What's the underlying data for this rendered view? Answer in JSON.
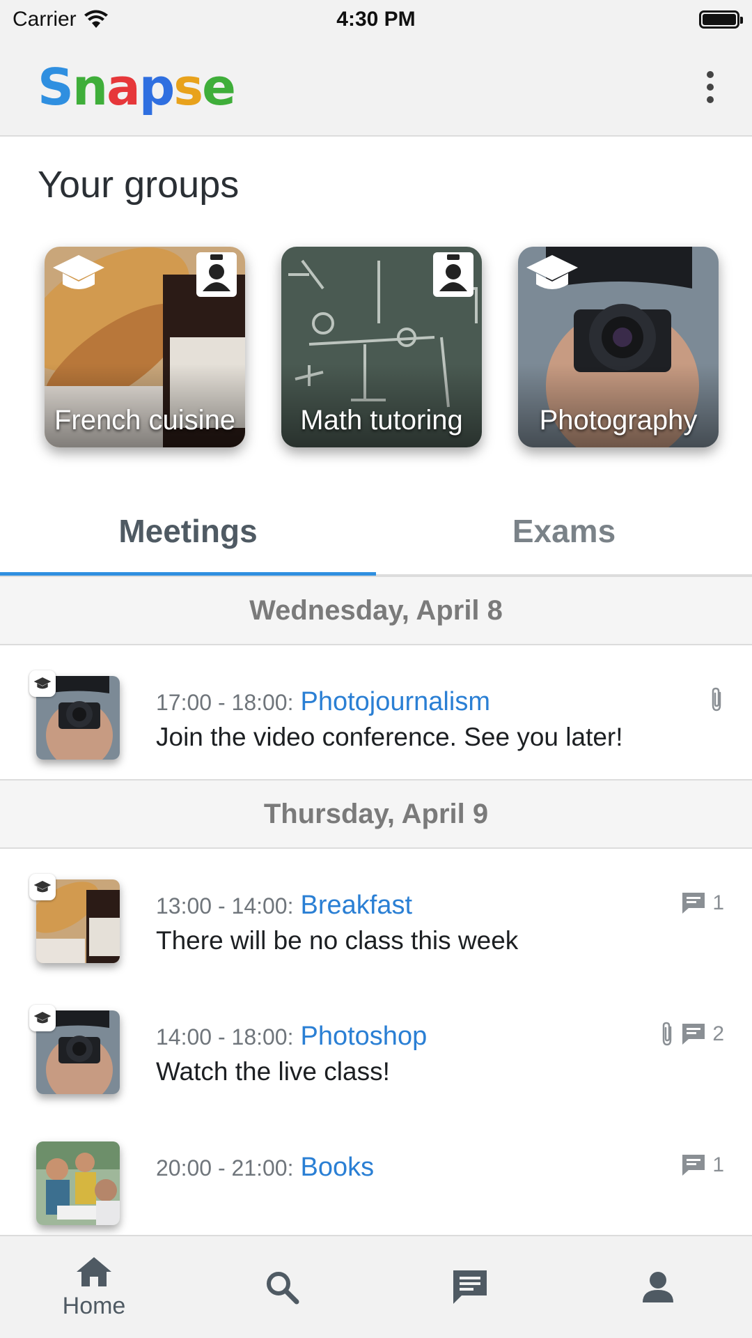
{
  "status_bar": {
    "carrier": "Carrier",
    "time": "4:30 PM"
  },
  "app_bar": {
    "logo": [
      "S",
      "n",
      "a",
      "p",
      "s",
      "e"
    ],
    "menu_icon": "more-vertical-icon"
  },
  "groups": {
    "title": "Your groups",
    "items": [
      {
        "label": "French cuisine",
        "role_icon": "graduation-cap-icon",
        "badge_icon": "id-badge-icon"
      },
      {
        "label": "Math tutoring",
        "role_icon": "",
        "badge_icon": "id-badge-icon"
      },
      {
        "label": "Photography",
        "role_icon": "graduation-cap-icon",
        "badge_icon": ""
      }
    ]
  },
  "tabs": [
    {
      "label": "Meetings",
      "active": true
    },
    {
      "label": "Exams",
      "active": false
    }
  ],
  "days": [
    {
      "header": "Wednesday, April 8",
      "meetings": [
        {
          "time": "17:00 - 18:00:",
          "title": "Photojournalism",
          "message": "Join the video conference. See you later!",
          "attachment": true,
          "comments": ""
        }
      ]
    },
    {
      "header": "Thursday, April 9",
      "meetings": [
        {
          "time": "13:00 - 14:00:",
          "title": "Breakfast",
          "message": "There will be no class this week",
          "attachment": false,
          "comments": "1"
        },
        {
          "time": "14:00 - 18:00:",
          "title": "Photoshop",
          "message": "Watch the live class!",
          "attachment": true,
          "comments": "2"
        },
        {
          "time": "20:00 - 21:00:",
          "title": "Books",
          "message": "",
          "attachment": false,
          "comments": "1"
        }
      ]
    }
  ],
  "bottom_nav": [
    {
      "label": "Home",
      "icon": "home-icon"
    },
    {
      "label": "",
      "icon": "search-icon"
    },
    {
      "label": "",
      "icon": "chat-icon"
    },
    {
      "label": "",
      "icon": "profile-icon"
    }
  ],
  "colors": {
    "accent": "#2f8fe0",
    "link": "#2a7fd4",
    "background": "#f2f2f2"
  }
}
